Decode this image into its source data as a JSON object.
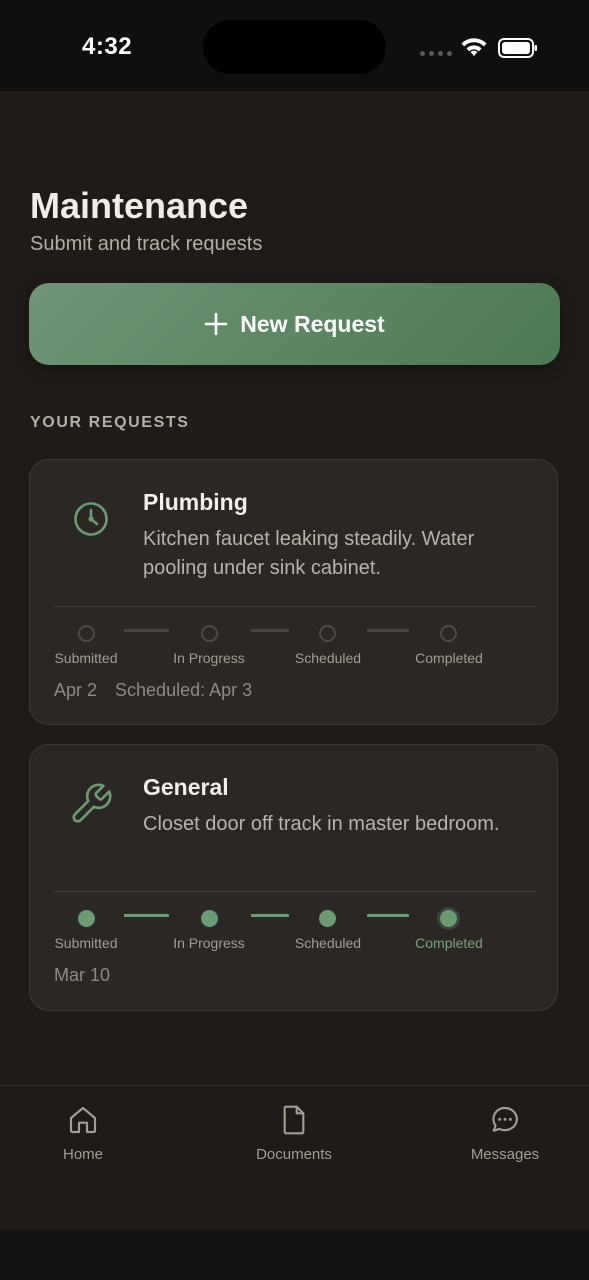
{
  "status_bar": {
    "time": "4:32"
  },
  "header": {
    "title": "Maintenance",
    "subtitle": "Submit and track requests"
  },
  "new_request_button": {
    "label": "New Request",
    "icon": "plus-icon"
  },
  "section_label": "YOUR REQUESTS",
  "steps_labels": [
    "Submitted",
    "In Progress",
    "Scheduled",
    "Completed"
  ],
  "requests": [
    {
      "category": "Plumbing",
      "icon": "clock-icon",
      "description": "Kitchen faucet leaking steadily. Water pooling under sink cabinet.",
      "completed_steps": 0,
      "date": "Apr 2",
      "scheduled": "Scheduled: Apr 3"
    },
    {
      "category": "General",
      "icon": "wrench-icon",
      "description": "Closet door off track in master bedroom.",
      "completed_steps": 4,
      "date": "Mar 10"
    }
  ],
  "tabbar": {
    "items": [
      {
        "label": "Home",
        "icon": "home-icon"
      },
      {
        "label": "Documents",
        "icon": "document-icon"
      },
      {
        "label": "Messages",
        "icon": "chat-icon"
      }
    ]
  },
  "colors": {
    "accent": "#6c9a72",
    "background": "#1e1b19",
    "card": "#2a2725"
  }
}
